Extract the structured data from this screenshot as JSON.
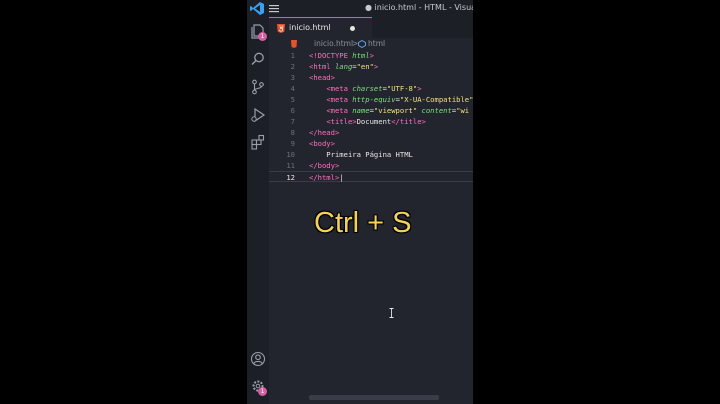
{
  "titlebar": {
    "title": "● inicio.html - HTML - Visual Studio"
  },
  "activity": {
    "explorer_badge": "1",
    "manage_badge": "1"
  },
  "tab": {
    "label": "inicio.html"
  },
  "breadcrumb": {
    "file": "inicio.html",
    "separator": ">",
    "element": "html"
  },
  "editor": {
    "lines": [
      {
        "n": "1",
        "parts": [
          [
            "t-tag",
            "<!DOCTYPE "
          ],
          [
            "t-attr",
            "html"
          ],
          [
            "t-tag",
            ">"
          ]
        ]
      },
      {
        "n": "2",
        "parts": [
          [
            "t-tag",
            "<html "
          ],
          [
            "t-attr",
            "lang"
          ],
          [
            "t-txt",
            "="
          ],
          [
            "t-str",
            "\"en\""
          ],
          [
            "t-tag",
            ">"
          ]
        ]
      },
      {
        "n": "3",
        "parts": [
          [
            "t-tag",
            "<head>"
          ]
        ]
      },
      {
        "n": "4",
        "parts": [
          [
            "t-txt",
            "    "
          ],
          [
            "t-tag",
            "<meta "
          ],
          [
            "t-attr",
            "charset"
          ],
          [
            "t-txt",
            "="
          ],
          [
            "t-str",
            "\"UTF-8\""
          ],
          [
            "t-tag",
            ">"
          ]
        ]
      },
      {
        "n": "5",
        "parts": [
          [
            "t-txt",
            "    "
          ],
          [
            "t-tag",
            "<meta "
          ],
          [
            "t-attr",
            "http-equiv"
          ],
          [
            "t-txt",
            "="
          ],
          [
            "t-str",
            "\"X-UA-Compatible\""
          ]
        ]
      },
      {
        "n": "6",
        "parts": [
          [
            "t-txt",
            "    "
          ],
          [
            "t-tag",
            "<meta "
          ],
          [
            "t-attr",
            "name"
          ],
          [
            "t-txt",
            "="
          ],
          [
            "t-str",
            "\"viewport\" "
          ],
          [
            "t-attr",
            "content"
          ],
          [
            "t-txt",
            "="
          ],
          [
            "t-str",
            "\"wi"
          ]
        ]
      },
      {
        "n": "7",
        "parts": [
          [
            "t-txt",
            "    "
          ],
          [
            "t-tag",
            "<title>"
          ],
          [
            "t-txt",
            "Document"
          ],
          [
            "t-tag",
            "</title>"
          ]
        ]
      },
      {
        "n": "8",
        "parts": [
          [
            "t-tag",
            "</head>"
          ]
        ]
      },
      {
        "n": "9",
        "parts": [
          [
            "t-tag",
            "<body>"
          ]
        ]
      },
      {
        "n": "10",
        "parts": [
          [
            "t-txt",
            "    Primeira Página HTML"
          ]
        ]
      },
      {
        "n": "11",
        "parts": [
          [
            "t-tag",
            "</body>"
          ]
        ]
      },
      {
        "n": "12",
        "parts": [
          [
            "t-tag",
            "</html>"
          ],
          [
            "t-txt",
            "|"
          ]
        ]
      }
    ]
  },
  "overlay": {
    "caption": "Ctrl + S"
  },
  "colors": {
    "accent": "#d55fa0",
    "tag": "#ff6ec0",
    "attr": "#7be07b",
    "string": "#f2e37a",
    "caption": "#f4d25a"
  }
}
